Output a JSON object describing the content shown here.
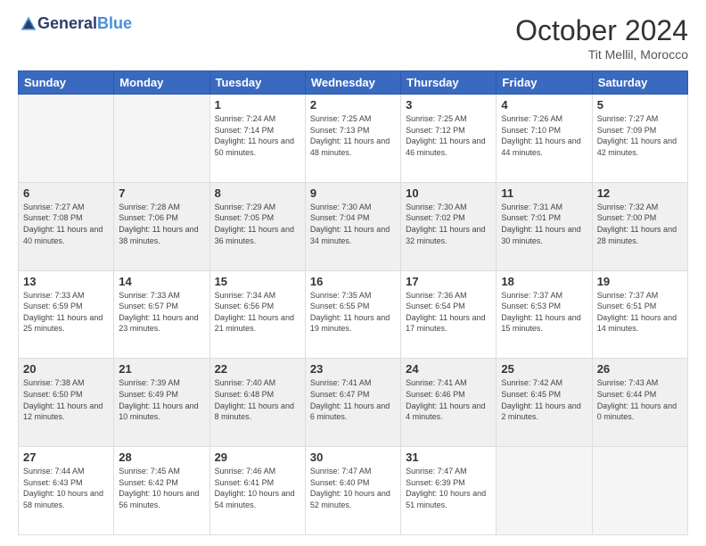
{
  "header": {
    "logo_general": "General",
    "logo_blue": "Blue",
    "month_title": "October 2024",
    "subtitle": "Tit Mellil, Morocco"
  },
  "days_of_week": [
    "Sunday",
    "Monday",
    "Tuesday",
    "Wednesday",
    "Thursday",
    "Friday",
    "Saturday"
  ],
  "weeks": [
    {
      "shaded": false,
      "days": [
        {
          "date": "",
          "empty": true
        },
        {
          "date": "",
          "empty": true
        },
        {
          "date": "1",
          "sunrise": "7:24 AM",
          "sunset": "7:14 PM",
          "daylight": "11 hours and 50 minutes."
        },
        {
          "date": "2",
          "sunrise": "7:25 AM",
          "sunset": "7:13 PM",
          "daylight": "11 hours and 48 minutes."
        },
        {
          "date": "3",
          "sunrise": "7:25 AM",
          "sunset": "7:12 PM",
          "daylight": "11 hours and 46 minutes."
        },
        {
          "date": "4",
          "sunrise": "7:26 AM",
          "sunset": "7:10 PM",
          "daylight": "11 hours and 44 minutes."
        },
        {
          "date": "5",
          "sunrise": "7:27 AM",
          "sunset": "7:09 PM",
          "daylight": "11 hours and 42 minutes."
        }
      ]
    },
    {
      "shaded": true,
      "days": [
        {
          "date": "6",
          "sunrise": "7:27 AM",
          "sunset": "7:08 PM",
          "daylight": "11 hours and 40 minutes."
        },
        {
          "date": "7",
          "sunrise": "7:28 AM",
          "sunset": "7:06 PM",
          "daylight": "11 hours and 38 minutes."
        },
        {
          "date": "8",
          "sunrise": "7:29 AM",
          "sunset": "7:05 PM",
          "daylight": "11 hours and 36 minutes."
        },
        {
          "date": "9",
          "sunrise": "7:30 AM",
          "sunset": "7:04 PM",
          "daylight": "11 hours and 34 minutes."
        },
        {
          "date": "10",
          "sunrise": "7:30 AM",
          "sunset": "7:02 PM",
          "daylight": "11 hours and 32 minutes."
        },
        {
          "date": "11",
          "sunrise": "7:31 AM",
          "sunset": "7:01 PM",
          "daylight": "11 hours and 30 minutes."
        },
        {
          "date": "12",
          "sunrise": "7:32 AM",
          "sunset": "7:00 PM",
          "daylight": "11 hours and 28 minutes."
        }
      ]
    },
    {
      "shaded": false,
      "days": [
        {
          "date": "13",
          "sunrise": "7:33 AM",
          "sunset": "6:59 PM",
          "daylight": "11 hours and 25 minutes."
        },
        {
          "date": "14",
          "sunrise": "7:33 AM",
          "sunset": "6:57 PM",
          "daylight": "11 hours and 23 minutes."
        },
        {
          "date": "15",
          "sunrise": "7:34 AM",
          "sunset": "6:56 PM",
          "daylight": "11 hours and 21 minutes."
        },
        {
          "date": "16",
          "sunrise": "7:35 AM",
          "sunset": "6:55 PM",
          "daylight": "11 hours and 19 minutes."
        },
        {
          "date": "17",
          "sunrise": "7:36 AM",
          "sunset": "6:54 PM",
          "daylight": "11 hours and 17 minutes."
        },
        {
          "date": "18",
          "sunrise": "7:37 AM",
          "sunset": "6:53 PM",
          "daylight": "11 hours and 15 minutes."
        },
        {
          "date": "19",
          "sunrise": "7:37 AM",
          "sunset": "6:51 PM",
          "daylight": "11 hours and 14 minutes."
        }
      ]
    },
    {
      "shaded": true,
      "days": [
        {
          "date": "20",
          "sunrise": "7:38 AM",
          "sunset": "6:50 PM",
          "daylight": "11 hours and 12 minutes."
        },
        {
          "date": "21",
          "sunrise": "7:39 AM",
          "sunset": "6:49 PM",
          "daylight": "11 hours and 10 minutes."
        },
        {
          "date": "22",
          "sunrise": "7:40 AM",
          "sunset": "6:48 PM",
          "daylight": "11 hours and 8 minutes."
        },
        {
          "date": "23",
          "sunrise": "7:41 AM",
          "sunset": "6:47 PM",
          "daylight": "11 hours and 6 minutes."
        },
        {
          "date": "24",
          "sunrise": "7:41 AM",
          "sunset": "6:46 PM",
          "daylight": "11 hours and 4 minutes."
        },
        {
          "date": "25",
          "sunrise": "7:42 AM",
          "sunset": "6:45 PM",
          "daylight": "11 hours and 2 minutes."
        },
        {
          "date": "26",
          "sunrise": "7:43 AM",
          "sunset": "6:44 PM",
          "daylight": "11 hours and 0 minutes."
        }
      ]
    },
    {
      "shaded": false,
      "days": [
        {
          "date": "27",
          "sunrise": "7:44 AM",
          "sunset": "6:43 PM",
          "daylight": "10 hours and 58 minutes."
        },
        {
          "date": "28",
          "sunrise": "7:45 AM",
          "sunset": "6:42 PM",
          "daylight": "10 hours and 56 minutes."
        },
        {
          "date": "29",
          "sunrise": "7:46 AM",
          "sunset": "6:41 PM",
          "daylight": "10 hours and 54 minutes."
        },
        {
          "date": "30",
          "sunrise": "7:47 AM",
          "sunset": "6:40 PM",
          "daylight": "10 hours and 52 minutes."
        },
        {
          "date": "31",
          "sunrise": "7:47 AM",
          "sunset": "6:39 PM",
          "daylight": "10 hours and 51 minutes."
        },
        {
          "date": "",
          "empty": true
        },
        {
          "date": "",
          "empty": true
        }
      ]
    }
  ],
  "labels": {
    "sunrise": "Sunrise:",
    "sunset": "Sunset:",
    "daylight": "Daylight:"
  }
}
